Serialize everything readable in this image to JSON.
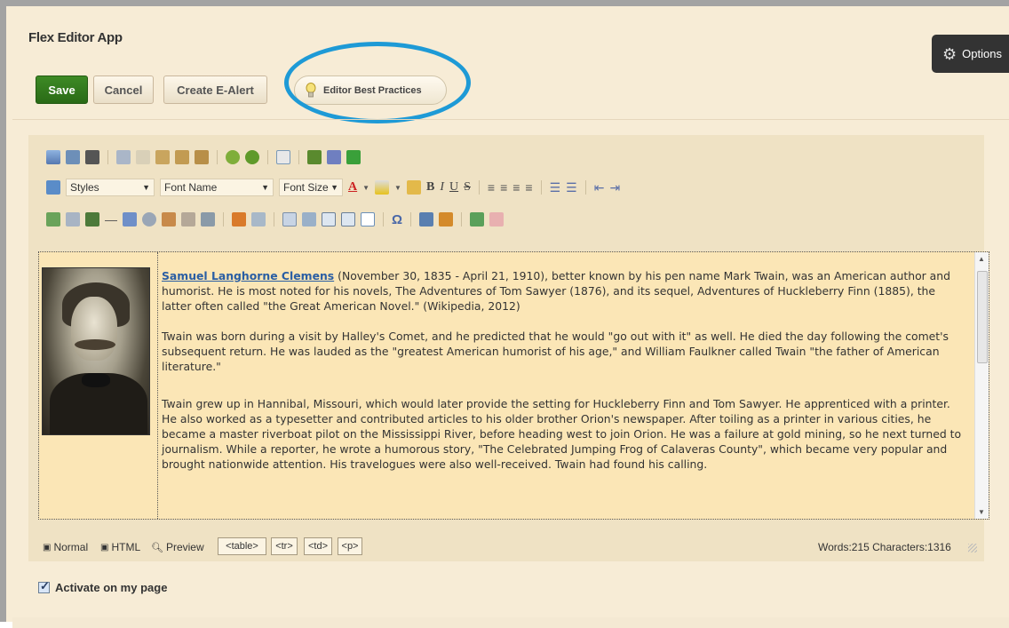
{
  "app": {
    "title": "Flex Editor App"
  },
  "toolbar": {
    "save_label": "Save",
    "cancel_label": "Cancel",
    "alert_label": "Create E-Alert",
    "best_practices_label": "Editor Best Practices",
    "options_label": "Options"
  },
  "editor_toolbar": {
    "styles_label": "Styles",
    "font_name_label": "Font Name",
    "font_size_label": "Font Size"
  },
  "content": {
    "link_text": "Samuel Langhorne Clemens",
    "p1_rest": " (November 30, 1835 - April 21, 1910), better known by his pen name Mark Twain, was an American author and humorist. He is most noted for his novels, The Adventures of Tom Sawyer (1876), and its sequel, Adventures of Huckleberry Finn (1885), the latter often called \"the Great American Novel.\" (Wikipedia, 2012)",
    "p2": "Twain was born during a visit by Halley's Comet, and he predicted that he would \"go out with it\" as well. He died the day following the comet's subsequent return. He was lauded as the \"greatest American humorist of his age,\" and William Faulkner called Twain \"the father of American literature.\"",
    "p3": "Twain grew up in Hannibal, Missouri, which would later provide the setting for Huckleberry Finn and Tom Sawyer. He apprenticed with a printer. He also worked as a typesetter and contributed articles to his older brother Orion's newspaper. After toiling as a printer in various cities, he became a master riverboat pilot on the Mississippi River, before heading west to join Orion. He was a failure at gold mining, so he next turned to journalism. While a reporter, he wrote a humorous story, \"The Celebrated Jumping Frog of Calaveras County\", which became very popular and brought nationwide attention. His travelogues were also well-received. Twain had found his calling."
  },
  "statusbar": {
    "modes": [
      {
        "label": "Normal",
        "icon": "design-mode-icon"
      },
      {
        "label": "HTML",
        "icon": "html-mode-icon"
      },
      {
        "label": "Preview",
        "icon": "preview-mode-icon"
      }
    ],
    "tags": [
      "<table>",
      "<tr>",
      "<td>",
      "<p>"
    ],
    "counts": "Words:215 Characters:1316"
  },
  "activate": {
    "label": "Activate on my page",
    "checked": true
  },
  "colors": {
    "save_green": "#3d8a25",
    "highlight_ring": "#1e9ad6",
    "content_bg": "#fbe6b6",
    "page_bg": "#f7ecd6"
  }
}
